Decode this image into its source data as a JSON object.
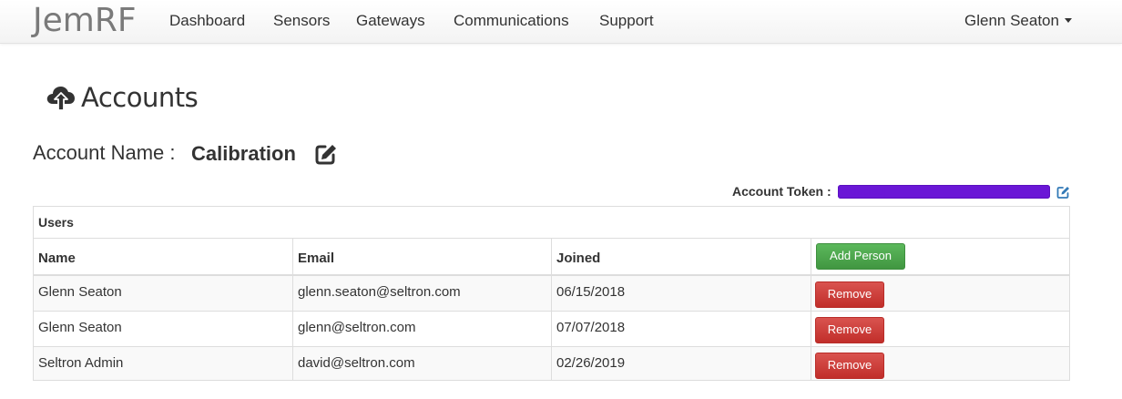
{
  "navbar": {
    "brand": "JemRF",
    "links": [
      "Dashboard",
      "Sensors",
      "Gateways",
      "Communications",
      "Support"
    ],
    "user": "Glenn Seaton"
  },
  "page": {
    "title": "Accounts",
    "title_icon": "cloud-upload-icon",
    "account_name_label": "Account Name :",
    "account_name_value": "Calibration",
    "account_token_label": "Account Token :",
    "account_token_value": "[redacted]"
  },
  "users_panel": {
    "heading": "Users",
    "columns": [
      "Name",
      "Email",
      "Joined"
    ],
    "add_button": "Add Person",
    "remove_label": "Remove",
    "rows": [
      {
        "name": "Glenn Seaton",
        "email": "glenn.seaton@seltron.com",
        "joined": "06/15/2018"
      },
      {
        "name": "Glenn Seaton",
        "email": "glenn@seltron.com",
        "joined": "07/07/2018"
      },
      {
        "name": "Seltron Admin",
        "email": "david@seltron.com",
        "joined": "02/26/2019"
      }
    ]
  },
  "colors": {
    "success": "#5cb85c",
    "danger": "#d9534f",
    "token_redaction": "#6a17d6",
    "edit_icon_accent": "#337ab7"
  }
}
